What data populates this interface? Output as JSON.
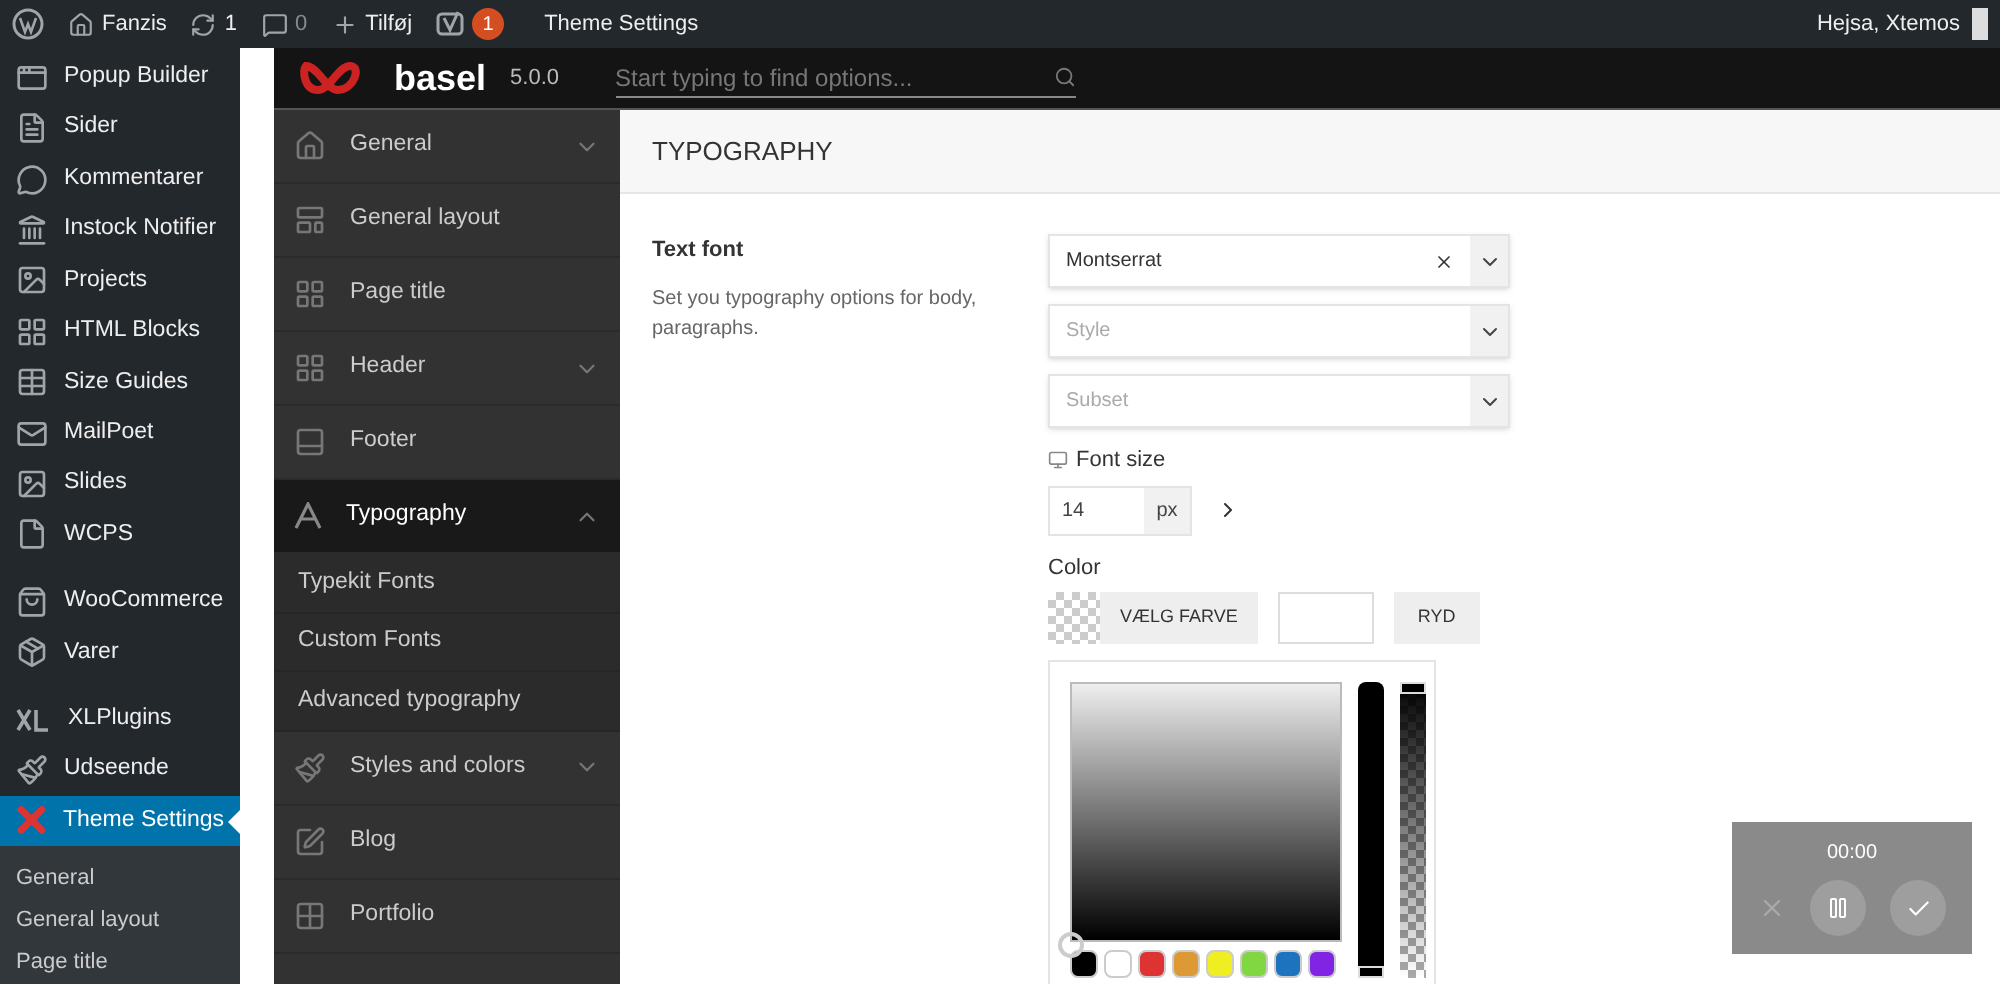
{
  "admin_bar": {
    "site": "Fanzis",
    "updates": "1",
    "comments": "0",
    "new": "Tilføj",
    "seo_badge": "1",
    "page": "Theme Settings",
    "greeting": "Hejsa, Xtemos"
  },
  "wp_menu": [
    {
      "label": "Popup Builder",
      "selected": false,
      "gap_before": false
    },
    {
      "label": "Sider",
      "selected": false,
      "gap_before": false
    },
    {
      "label": "Kommentarer",
      "selected": false,
      "gap_before": false
    },
    {
      "label": "Instock Notifier",
      "selected": false,
      "gap_before": false
    },
    {
      "label": "Projects",
      "selected": false,
      "gap_before": false
    },
    {
      "label": "HTML Blocks",
      "selected": false,
      "gap_before": false
    },
    {
      "label": "Size Guides",
      "selected": false,
      "gap_before": false
    },
    {
      "label": "MailPoet",
      "selected": false,
      "gap_before": false
    },
    {
      "label": "Slides",
      "selected": false,
      "gap_before": false
    },
    {
      "label": "WCPS",
      "selected": false,
      "gap_before": false
    },
    {
      "label": "WooCommerce",
      "selected": false,
      "gap_before": true
    },
    {
      "label": "Varer",
      "selected": false,
      "gap_before": false
    },
    {
      "label": "XLPlugins",
      "selected": false,
      "gap_before": true
    },
    {
      "label": "Udseende",
      "selected": false,
      "gap_before": false
    },
    {
      "label": "Theme Settings",
      "selected": true,
      "gap_before": false
    }
  ],
  "wp_submenu": [
    "General",
    "General layout",
    "Page title"
  ],
  "theme_header": {
    "logo": "basel",
    "version": "5.0.0",
    "search_placeholder": "Start typing to find options..."
  },
  "theme_menu": [
    {
      "label": "General",
      "has_children": true,
      "expanded": false,
      "selected": false
    },
    {
      "label": "General layout",
      "has_children": false,
      "selected": false
    },
    {
      "label": "Page title",
      "has_children": false,
      "selected": false
    },
    {
      "label": "Header",
      "has_children": true,
      "expanded": false,
      "selected": false
    },
    {
      "label": "Footer",
      "has_children": false,
      "selected": false
    },
    {
      "label": "Typography",
      "has_children": true,
      "expanded": true,
      "selected": true,
      "children": [
        "Typekit Fonts",
        "Custom Fonts",
        "Advanced typography"
      ]
    },
    {
      "label": "Styles and colors",
      "has_children": true,
      "expanded": false,
      "selected": false
    },
    {
      "label": "Blog",
      "has_children": false,
      "selected": false
    },
    {
      "label": "Portfolio",
      "has_children": false,
      "selected": false
    }
  ],
  "section": {
    "title": "TYPOGRAPHY",
    "field_label": "Text font",
    "field_description": "Set you typography options for body, paragraphs.",
    "font_family": "Montserrat",
    "style_placeholder": "Style",
    "subset_placeholder": "Subset",
    "font_size_label": "Font size",
    "font_size": "14",
    "font_size_unit": "px",
    "color_label": "Color",
    "pick_button": "VÆLG FARVE",
    "clear_button": "RYD",
    "swatches": [
      {
        "color": "#000000"
      },
      {
        "color": "#ffffff"
      },
      {
        "color": "#dd3333"
      },
      {
        "color": "#dd9933"
      },
      {
        "color": "#eeee22"
      },
      {
        "color": "#81d742"
      },
      {
        "color": "#1e73be"
      },
      {
        "color": "#8224e3"
      }
    ],
    "hue_slider": {
      "level": 0
    },
    "opacity_slider": {
      "level": 1
    }
  },
  "recorder": {
    "time": "00:00"
  }
}
